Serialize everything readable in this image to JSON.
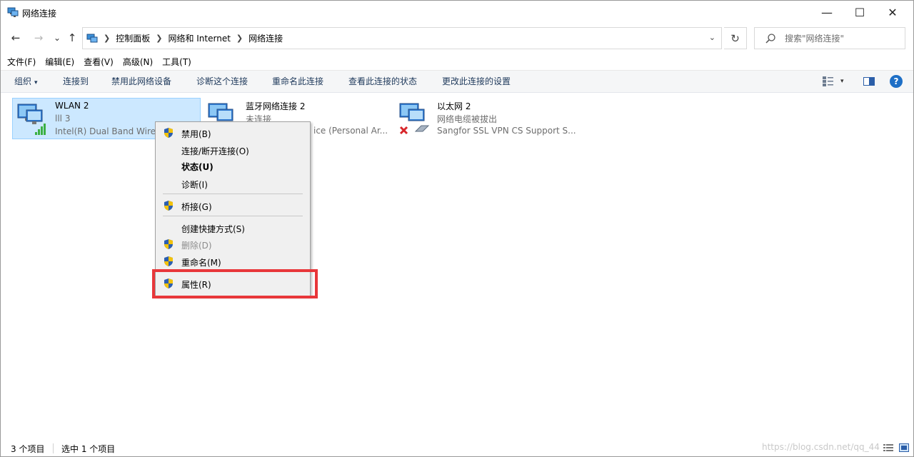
{
  "window": {
    "title": "网络连接",
    "controls": {
      "minimize": "—",
      "maximize": "☐",
      "close": "✕"
    }
  },
  "nav": {
    "back": "←",
    "forward": "→",
    "recent": "⌄",
    "up": "↑"
  },
  "address": {
    "breadcrumbs": [
      "控制面板",
      "网络和 Internet",
      "网络连接"
    ],
    "dropdown": "⌄",
    "refresh": "↻"
  },
  "search": {
    "placeholder": "搜索\"网络连接\""
  },
  "menubar": [
    "文件(F)",
    "编辑(E)",
    "查看(V)",
    "高级(N)",
    "工具(T)"
  ],
  "commandbar": {
    "organize": "组织",
    "organize_caret": "▾",
    "commands": [
      "连接到",
      "禁用此网络设备",
      "诊断这个连接",
      "重命名此连接",
      "查看此连接的状态",
      "更改此连接的设置"
    ],
    "view_caret": "▾",
    "help": "?"
  },
  "connections": [
    {
      "name": "WLAN 2",
      "status": "lll 3",
      "device": "Intel(R) Dual Band Wire",
      "type": "wifi",
      "selected": true
    },
    {
      "name": "蓝牙网络连接 2",
      "status": "未连接",
      "device": "ice (Personal Ar...",
      "type": "bluetooth",
      "selected": false
    },
    {
      "name": "以太网 2",
      "status": "网络电缆被拔出",
      "device": "Sangfor SSL VPN CS Support S...",
      "type": "ethernet-disconnected",
      "selected": false
    }
  ],
  "context_menu": {
    "items": [
      {
        "label": "禁用(B)",
        "shield": true
      },
      {
        "label": "连接/断开连接(O)",
        "shield": false
      },
      {
        "label": "状态(U)",
        "shield": false,
        "bold": true
      },
      {
        "label": "诊断(I)",
        "shield": false
      },
      {
        "label": "桥接(G)",
        "shield": true
      },
      {
        "label": "创建快捷方式(S)",
        "shield": false
      },
      {
        "label": "删除(D)",
        "shield": true,
        "disabled": true
      },
      {
        "label": "重命名(M)",
        "shield": true
      },
      {
        "label": "属性(R)",
        "shield": true,
        "highlighted": true
      }
    ]
  },
  "statusbar": {
    "count": "3 个项目",
    "selected": "选中 1 个项目",
    "watermark": "https://blog.csdn.net/qq_44"
  },
  "colors": {
    "selection_bg": "#cce8ff",
    "selection_border": "#99d1ff",
    "highlight_border": "#e8373a",
    "command_text": "#1e395b",
    "help_blue": "#1e6fc6"
  }
}
